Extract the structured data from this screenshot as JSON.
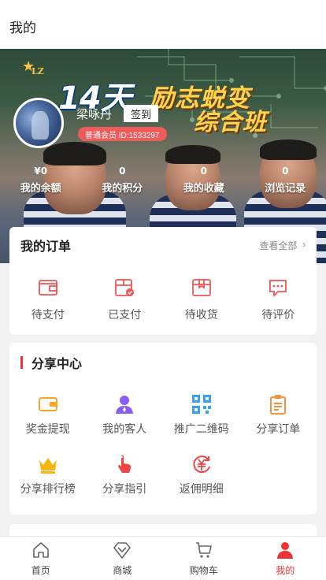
{
  "header": {
    "title": "我的"
  },
  "banner": {
    "logo_text": "LZ",
    "headline_number": "14天",
    "headline_slogan": "励志蜕变",
    "headline_class": "综合班"
  },
  "profile": {
    "username": "梁咏丹",
    "signin_label": "签到",
    "member_badge": "普通会员 ID:1533297"
  },
  "stats": [
    {
      "value": "¥0",
      "label": "我的余额"
    },
    {
      "value": "0",
      "label": "我的积分"
    },
    {
      "value": "0",
      "label": "我的收藏"
    },
    {
      "value": "0",
      "label": "浏览记录"
    }
  ],
  "orders": {
    "title": "我的订单",
    "view_all": "查看全部",
    "items": [
      {
        "label": "待支付",
        "icon": "wallet-icon"
      },
      {
        "label": "已支付",
        "icon": "paid-box-icon"
      },
      {
        "label": "待收货",
        "icon": "delivery-box-icon"
      },
      {
        "label": "待评价",
        "icon": "comment-icon"
      }
    ]
  },
  "share": {
    "title": "分享中心",
    "items": [
      {
        "label": "奖金提现",
        "icon": "wallet-icon",
        "color": "#f5a623"
      },
      {
        "label": "我的客人",
        "icon": "user-icon",
        "color": "#8b5cf6"
      },
      {
        "label": "推广二维码",
        "icon": "qrcode-icon",
        "color": "#3aa0e8"
      },
      {
        "label": "分享订单",
        "icon": "clipboard-icon",
        "color": "#f5923e"
      },
      {
        "label": "分享排行榜",
        "icon": "crown-icon",
        "color": "#f5b70f"
      },
      {
        "label": "分享指引",
        "icon": "pointer-hand-icon",
        "color": "#ef4444"
      },
      {
        "label": "返佣明细",
        "icon": "yuan-cycle-icon",
        "color": "#ef4444"
      }
    ]
  },
  "tabbar": [
    {
      "label": "首页",
      "icon": "home-icon",
      "active": false
    },
    {
      "label": "商城",
      "icon": "diamond-icon",
      "active": false
    },
    {
      "label": "购物车",
      "icon": "cart-icon",
      "active": false
    },
    {
      "label": "我的",
      "icon": "user-icon",
      "active": true
    }
  ],
  "colors": {
    "accent": "#e33333",
    "member_badge": "#ef5b5b"
  }
}
